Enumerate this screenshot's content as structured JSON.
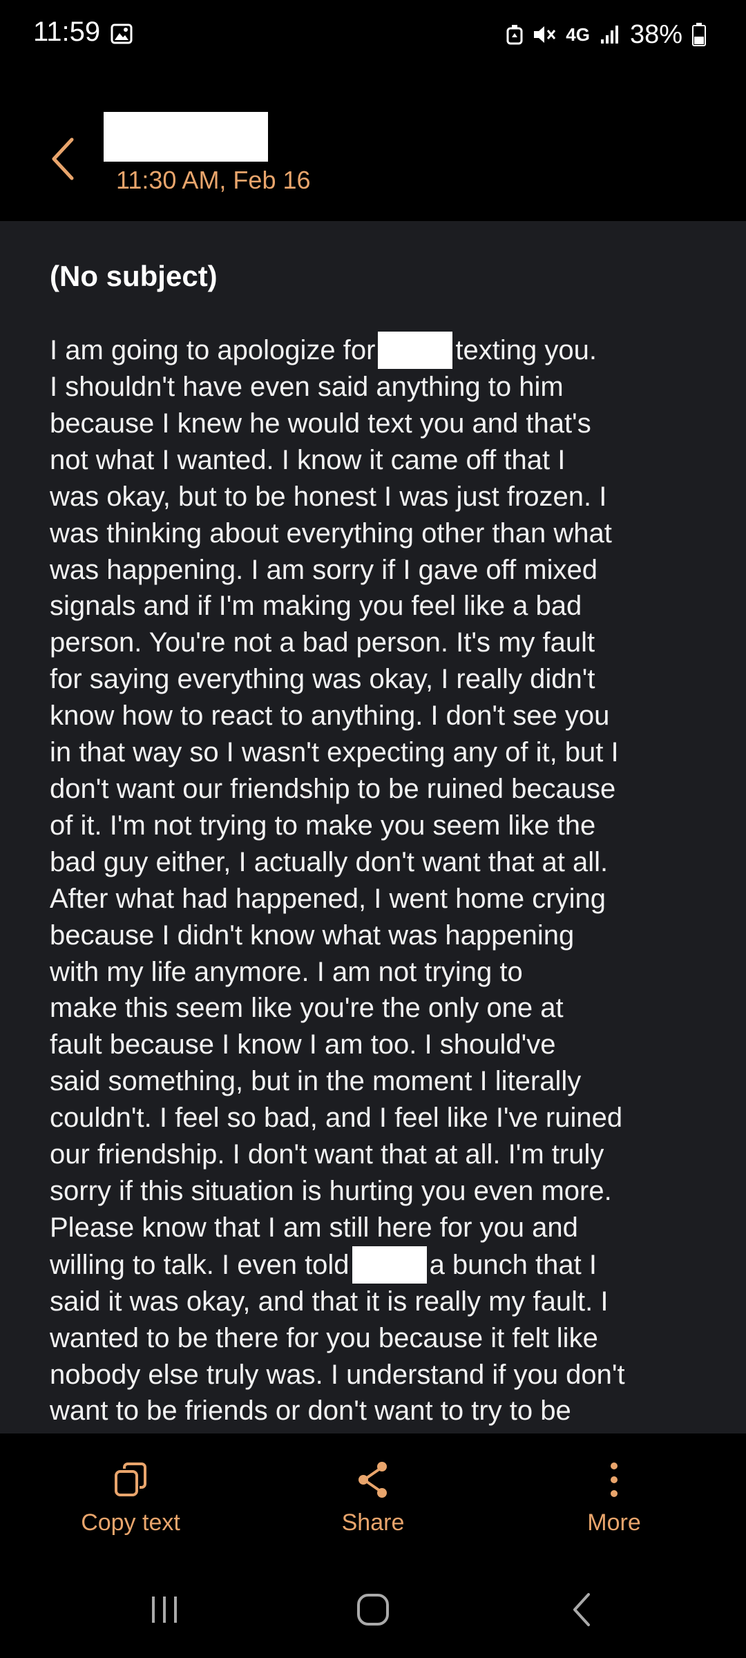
{
  "status_bar": {
    "time": "11:59",
    "network": "4G",
    "battery": "38%",
    "icons": [
      "gallery-icon",
      "recycle-icon",
      "mute-icon",
      "network-4g-icon",
      "signal-icon",
      "battery-icon"
    ]
  },
  "header": {
    "back_icon": "chevron-left-icon",
    "sender_redacted": true,
    "date": "11:30 AM, Feb 16"
  },
  "message": {
    "subject": "(No subject)",
    "lines": [
      {
        "before": "I am going to apologize for",
        "redacted": true,
        "after": "texting you."
      },
      {
        "text": "I shouldn't have even said anything to him"
      },
      {
        "text": "because I knew he would text you and that's"
      },
      {
        "text": "not what I wanted. I know it came off that I"
      },
      {
        "text": "was okay, but to be honest I was just frozen. I"
      },
      {
        "text": "was thinking about everything other than what"
      },
      {
        "text": "was happening. I am sorry if I gave off mixed"
      },
      {
        "text": "signals and if I'm making you feel like a bad"
      },
      {
        "text": "person. You're not a bad person. It's my fault"
      },
      {
        "text": "for saying everything was okay, I really didn't"
      },
      {
        "text": "know how to react to anything. I don't see you"
      },
      {
        "text": "in that way so I wasn't expecting any of it, but I"
      },
      {
        "text": "don't want our friendship to be ruined because"
      },
      {
        "text": "of it. I'm not trying to make you seem like the"
      },
      {
        "text": "bad guy either, I actually don't want that at all."
      },
      {
        "text": "After what had happened, I went home crying"
      },
      {
        "text": "because I didn't know what was happening"
      },
      {
        "text": "with my life anymore. I am not trying to"
      },
      {
        "text": "make this seem like you're the only one at"
      },
      {
        "text": "fault because I know I am too. I should've"
      },
      {
        "text": "said something, but in the moment I literally"
      },
      {
        "text": "couldn't. I feel so bad, and I feel like I've ruined"
      },
      {
        "text": "our friendship. I don't want that at all. I'm truly"
      },
      {
        "text": "sorry if this situation is hurting you even more."
      },
      {
        "text": "Please know that I am still here for you and"
      },
      {
        "before": "willing to talk. I even told",
        "redacted": true,
        "after": "a bunch that I"
      },
      {
        "text": "said it was okay, and that it is really my fault. I"
      },
      {
        "text": "wanted to be there for you because it felt like"
      },
      {
        "text": "nobody else truly was. I understand if you don't"
      },
      {
        "text": "want to be friends or don't want to try to be"
      }
    ]
  },
  "actions": {
    "copy": {
      "label": "Copy text",
      "icon": "copy-icon"
    },
    "share": {
      "label": "Share",
      "icon": "share-icon"
    },
    "more": {
      "label": "More",
      "icon": "more-vertical-icon"
    }
  },
  "nav": {
    "recents_icon": "recents-icon",
    "home_icon": "home-icon",
    "back_icon": "back-icon"
  },
  "colors": {
    "accent": "#e9a56c",
    "content_bg": "#1c1d21",
    "chrome_bg": "#000000",
    "text": "#f2f2f2"
  }
}
